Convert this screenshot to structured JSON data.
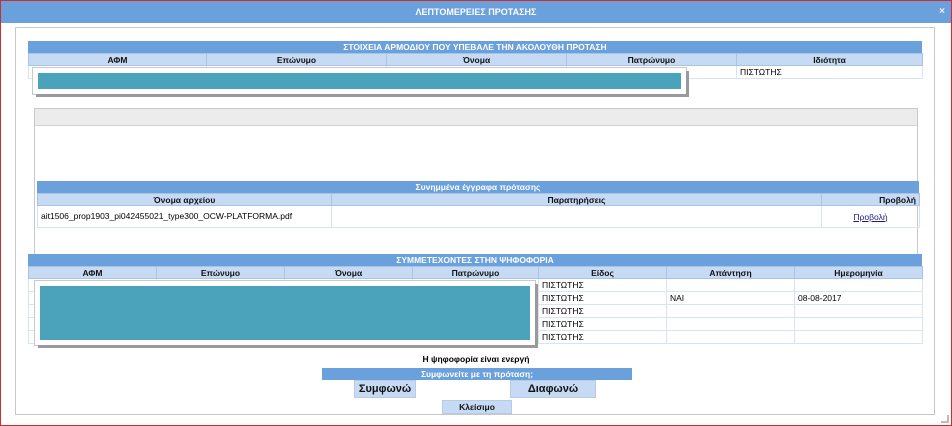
{
  "dialog": {
    "title": "ΛΕΠΤΟΜΕΡΕΙΕΣ ΠΡΟΤΑΣΗΣ",
    "close_icon": "×"
  },
  "submitter": {
    "header": "ΣΤΟΙΧΕΙΑ ΑΡΜΟΔΙΟΥ ΠΟΥ ΥΠΕΒΑΛΕ ΤΗΝ ΑΚΟΛΟΥΘΗ ΠΡΟΤΑΣΗ",
    "columns": [
      "ΑΦΜ",
      "Επώνυμο",
      "Όνομα",
      "Πατρώνυμο",
      "Ιδιότητα"
    ],
    "row": {
      "role": "ΠΙΣΤΩΤΗΣ"
    }
  },
  "attachments": {
    "header": "Συνημμένα έγγραφα πρότασης",
    "columns": [
      "Όνομα αρχείου",
      "Παρατηρήσεις",
      "Προβολή"
    ],
    "rows": [
      {
        "filename": "ait1506_prop1903_pi042455021_type300_OCW-PLATFORMA.pdf",
        "notes": "",
        "view": "Προβολή"
      }
    ]
  },
  "voters": {
    "header": "ΣΥΜΜΕΤΕΧΟΝΤΕΣ ΣΤΗΝ ΨΗΦΟΦΟΡΙΑ",
    "columns": [
      "ΑΦΜ",
      "Επώνυμο",
      "Όνομα",
      "Πατρώνυμο",
      "Είδος",
      "Απάντηση",
      "Ημερομηνία"
    ],
    "rows": [
      {
        "type": "ΠΙΣΤΩΤΗΣ",
        "answer": "",
        "date": ""
      },
      {
        "type": "ΠΙΣΤΩΤΗΣ",
        "answer": "ΝΑΙ",
        "date": "08-08-2017"
      },
      {
        "type": "ΠΙΣΤΩΤΗΣ",
        "answer": "",
        "date": ""
      },
      {
        "type": "ΠΙΣΤΩΤΗΣ",
        "answer": "",
        "date": ""
      },
      {
        "type": "ΠΙΣΤΩΤΗΣ",
        "answer": "",
        "date": ""
      }
    ]
  },
  "voting": {
    "status": "Η ψηφοφορία είναι ενεργή",
    "question": "Συμφωνείτε με τη πρόταση;",
    "agree_label": "Συμφωνώ",
    "disagree_label": "Διαφωνώ",
    "close_label": "Κλείσιμο"
  },
  "colors": {
    "header_blue": "#6aa0dc",
    "column_header": "#c6daf3",
    "redaction": "#4aa3ba",
    "dialog_border": "#c9302c"
  }
}
